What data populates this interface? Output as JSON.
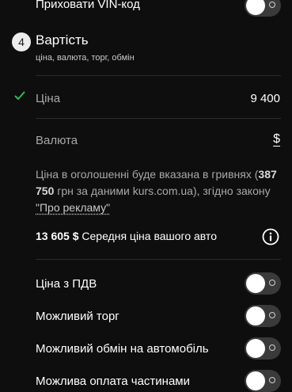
{
  "hide_vin": {
    "label": "Приховати VIN-код",
    "enabled": false
  },
  "section": {
    "number": "4",
    "title": "Вартість",
    "subtitle": "ціна, валюта, торг, обмін"
  },
  "price": {
    "label": "Ціна",
    "value": "9 400",
    "completed": true
  },
  "currency": {
    "label": "Валюта",
    "symbol": "$"
  },
  "note": {
    "text_before": "Ціна в оголошенні буде вказана в гривнях (",
    "uah_amount": "387 750",
    "text_mid": " грн за даними kurs.com.ua), згідно закону ",
    "link_text": "\"Про рекламу\""
  },
  "average": {
    "amount": "13 605 $",
    "label": "Середня ціна вашого авто"
  },
  "options": [
    {
      "label": "Ціна з ПДВ",
      "enabled": false
    },
    {
      "label": "Можливий торг",
      "enabled": false
    },
    {
      "label": "Можливий обмін на автомобіль",
      "enabled": false
    },
    {
      "label": "Можлива оплата частинами",
      "enabled": false
    }
  ],
  "colors": {
    "background": "#0e0e0e",
    "check": "#2eb85c",
    "toggle_track": "#3a3a3a"
  }
}
